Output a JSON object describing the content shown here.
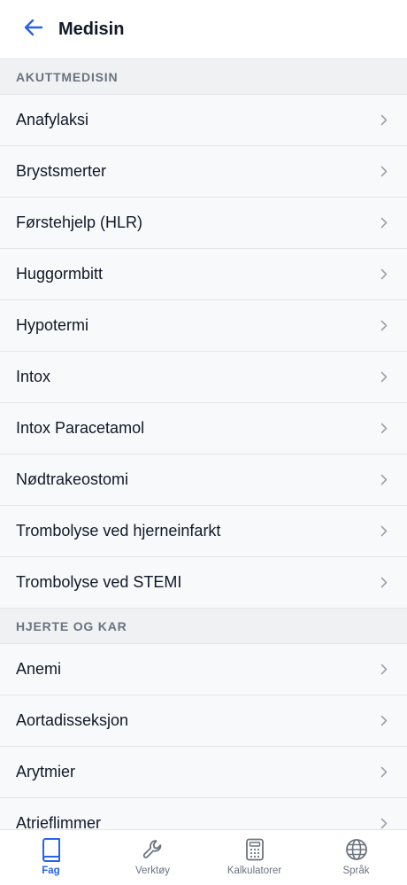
{
  "header": {
    "title": "Medisin",
    "back_icon": "arrow-left-icon"
  },
  "sections": [
    {
      "title": "AKUTTMEDISIN",
      "items": [
        "Anafylaksi",
        "Brystsmerter",
        "Førstehjelp (HLR)",
        "Huggormbitt",
        "Hypotermi",
        "Intox",
        "Intox Paracetamol",
        "Nødtrakeostomi",
        "Trombolyse ved hjerneinfarkt",
        "Trombolyse ved STEMI"
      ]
    },
    {
      "title": "HJERTE OG KAR",
      "items": [
        "Anemi",
        "Aortadisseksjon",
        "Arytmier",
        "Atrieflimmer"
      ]
    }
  ],
  "tabs": [
    {
      "label": "Fag",
      "icon": "book-icon",
      "active": true
    },
    {
      "label": "Verktøy",
      "icon": "wrench-icon",
      "active": false
    },
    {
      "label": "Kalkulatorer",
      "icon": "calculator-icon",
      "active": false
    },
    {
      "label": "Språk",
      "icon": "globe-icon",
      "active": false
    }
  ],
  "colors": {
    "accent": "#2563eb",
    "text": "#111827",
    "muted": "#6b7280",
    "background": "#f8f9fa",
    "section_background": "#eff1f3",
    "divider": "#e3e5e8"
  }
}
